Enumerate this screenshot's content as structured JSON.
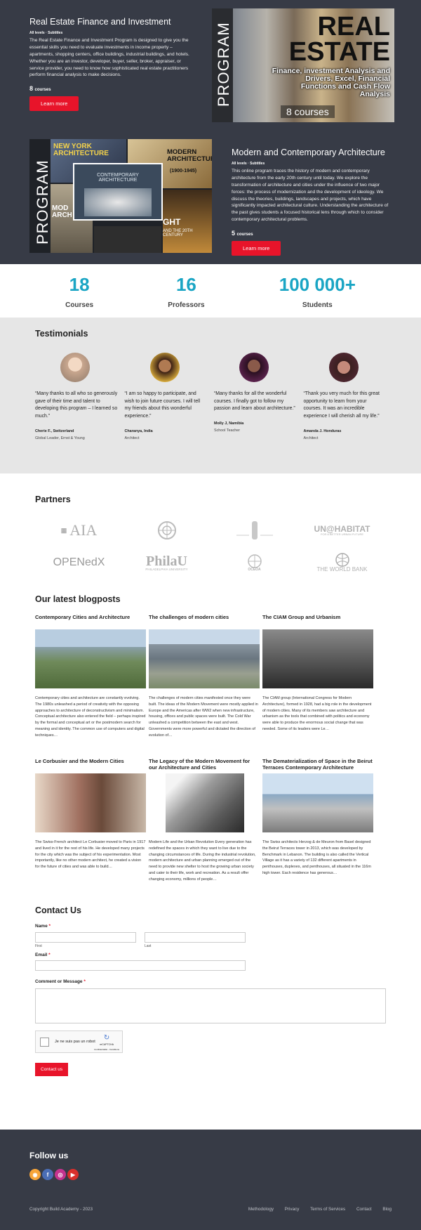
{
  "program1": {
    "title": "Real Estate Finance and Investment",
    "sub": "All levels · Subtitles",
    "desc": "The Real Estate Finance and Investment Program is designed to give you the essential skills you need to evaluate investments in income property – apartments, shopping centers, office buildings, industrial buildings, and hotels. Whether you are an investor, developer, buyer, seller, broker, appraiser, or service provider, you need to know how sophisticated real estate practitioners perform financial analysis to make decisions.",
    "count": "8",
    "count_label": "courses",
    "button": "Learn more",
    "image": {
      "vertical": "PROGRAM",
      "big1": "REAL",
      "big2": "ESTATE",
      "tagline": "Finance, investment Analysis and Drivers, Excel, Financial Functions and Cash Flow Analysis",
      "count_text": "8 courses"
    }
  },
  "program2": {
    "title": "Modern and Contemporary Architecture",
    "sub": "All levels · Subtitles",
    "desc": "This online program traces the history of modern and contemporary architecture from the early 20th century until today. We explore the transformation of architecture and cities under the influence of two major forces: the process of modernization and the development of ideology. We discuss the theories, buildings, landscapes and projects, which have significantly impacted architectural culture. Understanding the architecture of the past gives students a focused historical lens through which to consider contemporary architectural problems.",
    "count": "5",
    "count_label": "courses",
    "button": "Learn more",
    "image": {
      "vertical": "PROGRAM",
      "q1": "NEW YORK ARCHITECTURE",
      "q2": "MODERN ARCHITECTURE",
      "q2b": "(1900-1945)",
      "center": "CONTEMPORARY ARCHITECTURE",
      "q4": "AND THE 20TH CENTURY",
      "q3": "MOD ARCHI",
      "q5": "GHT"
    }
  },
  "stats": [
    {
      "num": "18",
      "label": "Courses"
    },
    {
      "num": "16",
      "label": "Professors"
    },
    {
      "num": "100 000+",
      "label": "Students"
    }
  ],
  "testimonials": {
    "title": "Testimonials",
    "items": [
      {
        "quote": "“Many thanks to all who so generously gave of their time and talent to developing this program – I learned so much.”",
        "name": "Cherie F., Switzerland",
        "role": "Global Leader, Ernst & Young",
        "avatar_color": "#c9a78f"
      },
      {
        "quote": "“I am so happy to  participate, and wish to join future courses. I will tell my friends about this wonderful experience.”",
        "name": "Charanya, India",
        "role": "Architect",
        "avatar_color": "#6b3a2a"
      },
      {
        "quote": "“Many thanks for all the wonderful courses. I finally got to follow my passion and learn about architecture.”",
        "name": "Molly J, Namibia",
        "role": "School Teacher",
        "avatar_color": "#4a2240"
      },
      {
        "quote": "“Thank you very much for this great opportunity to learn from your courses. It was an incredible experience I will cherish all my life.”",
        "name": "Amanda J. Honduras",
        "role": "Architect",
        "avatar_color": "#7a3b3b"
      }
    ]
  },
  "partners": {
    "title": "Partners",
    "logos": [
      "AIA",
      "UN",
      "",
      "UN@HABITAT",
      "OPENedX",
      "PhilaU",
      "OCEOA",
      "THE WORLD BANK"
    ],
    "logo_sub": [
      "",
      "",
      "",
      "FOR A BETTER URBAN FUTURE",
      "",
      "PHILADELPHIA UNIVERSITY",
      "",
      ""
    ]
  },
  "blog": {
    "title": "Our latest blogposts",
    "posts": [
      {
        "title": "Contemporary Cities and Architecture",
        "text": "Contemporary cities and architecture are constantly evolving. The 1980s unleashed a period of creativity with the opposing approaches to architecture of deconstructivism and minimalism. Conceptual architecture also entered the field – perhaps inspired by the formal and conceptual art or the postmodern search for meaning and identity.  The common use of computers and digital techniques…",
        "thumb": "#6f8a5a"
      },
      {
        "title": "The challenges of modern cities",
        "text": "The challenges of modern cities manifested once they were built. The ideas of the Modern Movement were mostly applied in Europe and the Americas after WW2 when new infrastructure, housing, offices and public spaces were built. The Cold War unleashed a competition between the east and west. Governments were more powerful and dictated the direction of evolution of…",
        "thumb": "#7a8794"
      },
      {
        "title": "The CIAM Group and Urbanism",
        "text": "The CIAM group (International Congress for Modern Architecture), formed in 1928, had a big role in the development of modern cities. Many of its members saw architecture and urbanism as the tools that combined with politics and economy were able to produce the enormous social change that was needed. Some of its leaders were Le…",
        "thumb": "#4a4a4a"
      },
      {
        "title": "Le Corbusier and the Modern Cities",
        "text": "The Swiss-French architect Le Corbusier moved to Paris in 1917 and lived in it for the rest of his life. He developed many projects for the city which was the subject of his experimentation. Most importantly, like no other modern architect, he created a vision for the future of cities and was able to build…",
        "thumb": "#8a6a5a"
      },
      {
        "title": "The Legacy of the Modern Movement for our Architecture and Cities",
        "text": "Modern Life and the Urban Revolution Every generation has redefined the spaces in which they want to live due to the changing circumstances of life. During the industrial revolution, modern architecture and urban planning emerged out of the need to provide new shelter to host the growing urban society and cater to their life, work and recreation. As a result offer changing economy, millions of people…",
        "thumb": "#9a9a9a"
      },
      {
        "title": "The Dematerialization of Space in the Beirut Terraces Contemporary Architecture",
        "text": "The Swiss architects Herzog & de Meuron from Basel designed the Beirut Terraces tower in 2013, which was developed by Benchmark in Lebanon. The building is also called the Vertical Village as it has a variety of 132 different apartments in penthouses, duplexes, and penthouses, all situated in the 116m high tower. Each residence has generous…",
        "thumb": "#9ab0c4"
      }
    ]
  },
  "contact": {
    "title": "Contact Us",
    "name_label": "Name",
    "first_hint": "First",
    "last_hint": "Last",
    "email_label": "Email",
    "message_label": "Comment or Message",
    "required": "*",
    "captcha_text": "Je ne suis pas un robot",
    "captcha_sub": "reCAPTCHA",
    "captcha_links": "Confidentialité - Conditions",
    "submit": "Contact us"
  },
  "footer": {
    "follow": "Follow us",
    "socials": [
      {
        "icon": "rss-icon",
        "color": "#f7a53a",
        "glyph": "◉"
      },
      {
        "icon": "facebook-icon",
        "color": "#4a6db5",
        "glyph": "f"
      },
      {
        "icon": "instagram-icon",
        "color": "#c5338f",
        "glyph": "◎"
      },
      {
        "icon": "youtube-icon",
        "color": "#d9302c",
        "glyph": "▶"
      }
    ],
    "copyright": "Copyright Build Academy - 2023",
    "links": [
      "Methodology",
      "Privacy",
      "Terms of Services",
      "Contact",
      "Blog"
    ]
  }
}
